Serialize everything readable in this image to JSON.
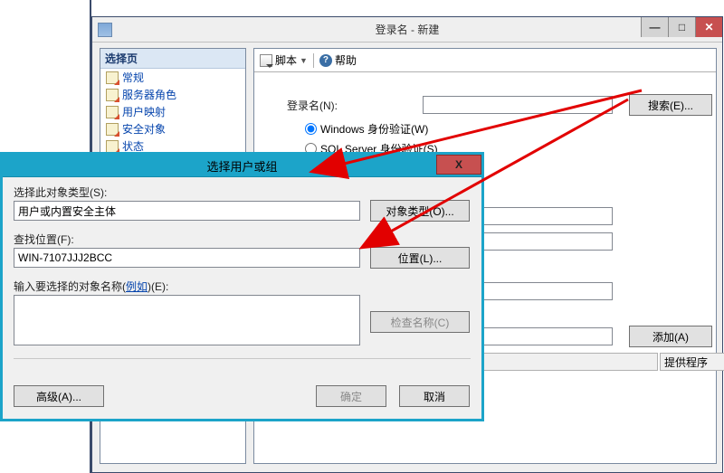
{
  "main_window": {
    "title": "登录名 - 新建",
    "toolbar": {
      "script_label": "脚本",
      "help_label": "帮助"
    },
    "sidebar": {
      "header": "选择页",
      "items": [
        {
          "label": "常规"
        },
        {
          "label": "服务器角色"
        },
        {
          "label": "用户映射"
        },
        {
          "label": "安全对象"
        },
        {
          "label": "状态"
        }
      ]
    },
    "form": {
      "login_name_label": "登录名(N):",
      "login_name_value": "",
      "search_button": "搜索(E)...",
      "auth_windows_label": "Windows 身份验证(W)",
      "auth_sql_label": "SQL Server 身份验证(S)",
      "add_button": "添加(A)",
      "provider_header": "提供程序"
    }
  },
  "dialog": {
    "title": "选择用户或组",
    "close_label": "X",
    "object_type_label": "选择此对象类型(S):",
    "object_type_value": "用户或内置安全主体",
    "object_type_button": "对象类型(O)...",
    "location_label": "查找位置(F):",
    "location_value": "WIN-7107JJJ2BCC",
    "location_button": "位置(L)...",
    "names_label_prefix": "输入要选择的对象名称(",
    "names_label_link": "例如",
    "names_label_suffix": ")(E):",
    "names_value": "",
    "check_names_button": "检查名称(C)",
    "advanced_button": "高级(A)...",
    "ok_button": "确定",
    "cancel_button": "取消"
  }
}
